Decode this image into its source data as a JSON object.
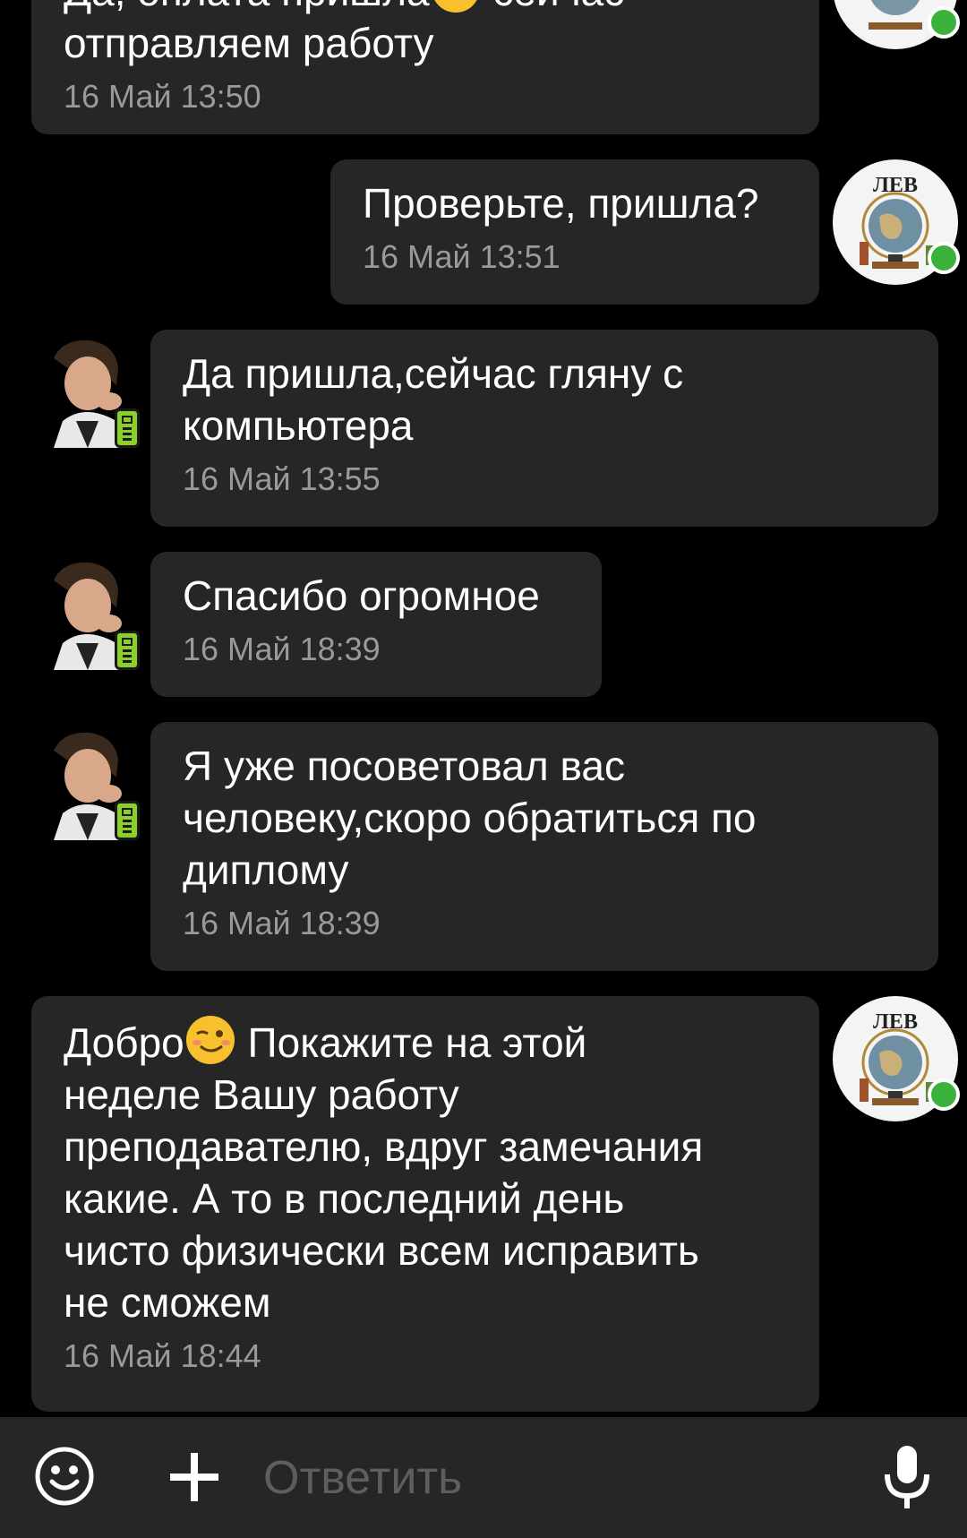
{
  "messages": [
    {
      "sender": "school",
      "text": "Да, оплата пришла",
      "text_tail": " сейчас",
      "text2": "отправляем работу",
      "time": "16 Май 13:50"
    },
    {
      "sender": "school",
      "text": "Проверьте, пришла?",
      "time": "16 Май 13:51"
    },
    {
      "sender": "user",
      "text": "Да пришла,сейчас гляну с\nкомпьютера",
      "time": "16 Май 13:55"
    },
    {
      "sender": "user",
      "text": "Спасибо огромное",
      "time": "16 Май 18:39"
    },
    {
      "sender": "user",
      "text": "Я уже посоветовал вас\nчеловеку,скоро обратиться по\nдиплому",
      "time": "16 Май 18:39"
    },
    {
      "sender": "school",
      "text_before_emoji": "Добро",
      "text_after_emoji": " Покажите на этой",
      "text_rest": "неделе Вашу работу\nпреподавателю, вдруг замечания\nкакие. А то в последний день\nчисто физически всем исправить\nне сможем",
      "time": "16 Май 18:44"
    }
  ],
  "avatar_label": "ЛЕВ",
  "compose": {
    "placeholder": "Ответить",
    "emoji_icon": "smiley-icon",
    "attach_icon": "plus-icon",
    "mic_icon": "microphone-icon"
  },
  "colors": {
    "background": "#000000",
    "bubble": "#262626",
    "timestamp": "#9a9a9a",
    "online": "#3bb23b",
    "placeholder": "#5e5e5e"
  }
}
